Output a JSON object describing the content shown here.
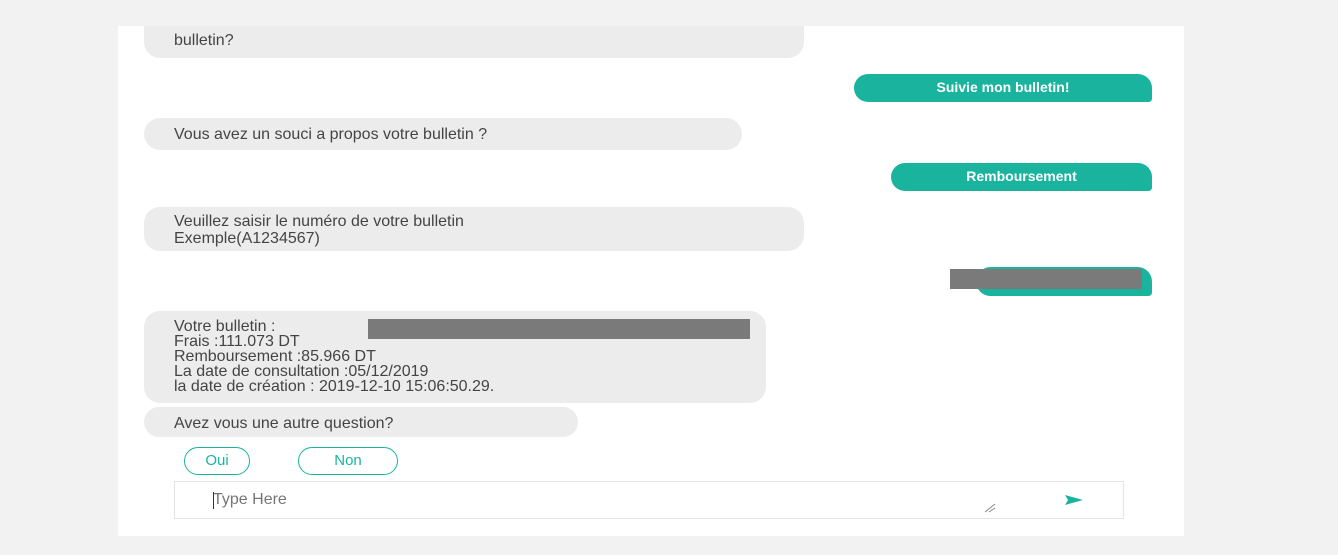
{
  "messages": {
    "bot_top_line2": "bulletin?",
    "user_follow": "Suivie mon bulletin!",
    "bot_souci": "Vous avez un souci a propos votre bulletin ?",
    "user_rembours": "Remboursement",
    "bot_saisir_line1": "Veuillez saisir le numéro de votre bulletin",
    "bot_saisir_line2": "Exemple(A1234567)",
    "bot_result": {
      "line1": "Votre bulletin :",
      "line2": "Frais :111.073   DT",
      "line3": "Remboursement :85.966  DT",
      "line4": "La date de consultation  :05/12/2019",
      "line5": "la date de création   : 2019-12-10 15:06:50.29."
    },
    "bot_question": "Avez vous une autre question?"
  },
  "choices": {
    "yes": "Oui",
    "no": "Non"
  },
  "input": {
    "placeholder": "Type Here"
  },
  "colors": {
    "accent": "#1ab49e",
    "bot_bubble": "#ececec",
    "redaction": "#7a7a7a",
    "page_background": "#f2f2f2"
  },
  "icons": {
    "send": "send-arrow-icon",
    "resize": "resize-handle-icon"
  }
}
